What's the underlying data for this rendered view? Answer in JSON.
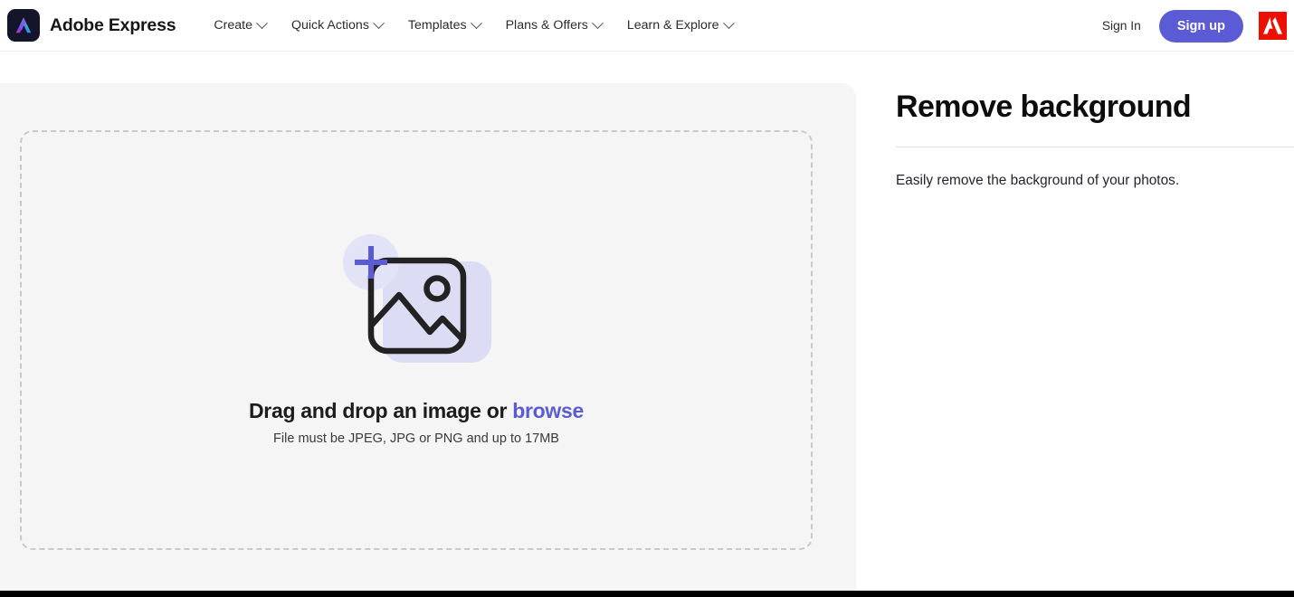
{
  "brand": {
    "name": "Adobe Express",
    "logo_icon": "adobe-express-logo-icon",
    "mark_background": "#14142b"
  },
  "nav": {
    "links": [
      {
        "label": "Create",
        "has_dropdown": true
      },
      {
        "label": "Quick Actions",
        "has_dropdown": true
      },
      {
        "label": "Templates",
        "has_dropdown": true
      },
      {
        "label": "Plans & Offers",
        "has_dropdown": true
      },
      {
        "label": "Learn & Explore",
        "has_dropdown": true
      }
    ],
    "sign_in_label": "Sign In",
    "sign_up_label": "Sign up",
    "adobe_logo_icon": "adobe-logo-icon"
  },
  "upload": {
    "icon": "add-image-icon",
    "headline_prefix": "Drag and drop an image or ",
    "browse_label": "browse",
    "file_requirements": "File must be JPEG, JPG or PNG and up to 17MB"
  },
  "info": {
    "title": "Remove background",
    "description": "Easily remove the background of your photos."
  },
  "colors": {
    "accent_purple": "#5b5bd6",
    "accent_purple_light": "#e3e3f8",
    "accent_purple_soft": "#dcdcf5",
    "adobe_red": "#eb1000",
    "card_background": "#f5f5f5",
    "dashed_border": "#c9c9c9",
    "bottom_bar": "#000000"
  }
}
